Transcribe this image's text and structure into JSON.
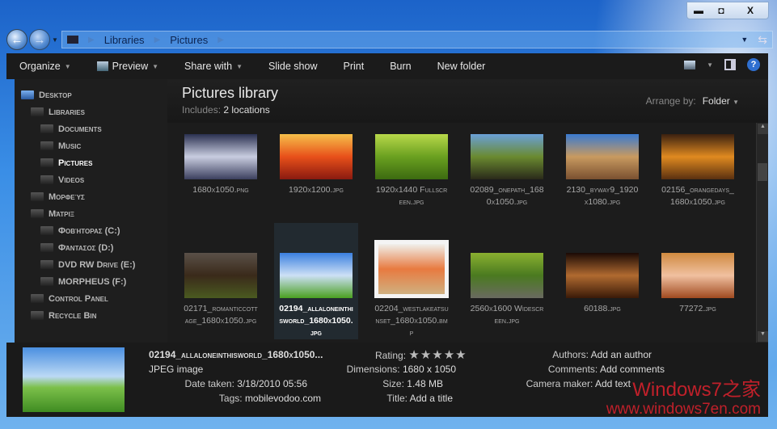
{
  "window": {
    "minimize": "▬",
    "maximize": "◘",
    "close": "X"
  },
  "address": {
    "crumbs": [
      "Libraries",
      "Pictures"
    ]
  },
  "toolbar": {
    "items": [
      {
        "label": "Organize",
        "caret": true
      },
      {
        "label": "Preview",
        "caret": true
      },
      {
        "label": "Share with",
        "caret": true
      },
      {
        "label": "Slide show"
      },
      {
        "label": "Print"
      },
      {
        "label": "Burn"
      },
      {
        "label": "New folder"
      }
    ],
    "help": "?"
  },
  "sidebar": {
    "items": [
      {
        "label": "Desktop",
        "level": 0
      },
      {
        "label": "Libraries",
        "level": 1
      },
      {
        "label": "Documents",
        "level": 2
      },
      {
        "label": "Music",
        "level": 2
      },
      {
        "label": "Pictures",
        "level": 2,
        "selected": true
      },
      {
        "label": "Videos",
        "level": 2
      },
      {
        "label": "Μορφεύς",
        "level": 1
      },
      {
        "label": "Μάτριξ",
        "level": 1
      },
      {
        "label": "Φοβήτορας (C:)",
        "level": 2
      },
      {
        "label": "Φάντασος (D:)",
        "level": 2
      },
      {
        "label": "DVD RW Drive (E:)",
        "level": 2
      },
      {
        "label": "MORPHEUS (F:)",
        "level": 2
      },
      {
        "label": "Control Panel",
        "level": 1
      },
      {
        "label": "Recycle Bin",
        "level": 1
      }
    ]
  },
  "library": {
    "title": "Pictures library",
    "includes_label": "Includes:",
    "includes_value": "2 locations",
    "arrange_label": "Arrange by:",
    "arrange_value": "Folder"
  },
  "files": [
    {
      "name": "1680x1050.png",
      "colors": [
        "#2a3050",
        "#c9cde0",
        "#3b3f5e"
      ]
    },
    {
      "name": "1920x1200.jpg",
      "colors": [
        "#f6c04a",
        "#e8501a",
        "#8a1a10"
      ]
    },
    {
      "name": "1920x1440 Fullscreen.jpg",
      "colors": [
        "#b8d84a",
        "#6aa020",
        "#3c6a10"
      ]
    },
    {
      "name": "02089_onepath_1680x1050.jpg",
      "colors": [
        "#6aa0d8",
        "#6a8a30",
        "#2a2a1a"
      ]
    },
    {
      "name": "2130_byway9_1920x1080.jpg",
      "colors": [
        "#3a7ad0",
        "#c89a60",
        "#7a5030"
      ]
    },
    {
      "name": "02156_orangedays_1680x1050.jpg",
      "colors": [
        "#3a2010",
        "#e08a20",
        "#5a3010"
      ]
    },
    {
      "name": "02171_romanticcottage_1680x1050.jpg",
      "colors": [
        "#5a5048",
        "#3a2a1a",
        "#4a5a20"
      ]
    },
    {
      "name": "02194_allaloneinthisworld_1680x1050.jpg",
      "colors": [
        "#3a80e0",
        "#cde0f5",
        "#4aa020"
      ],
      "selected": true
    },
    {
      "name": "02204_westlakeatsunset_1680x1050.bmp",
      "colors": [
        "#f0f0ec",
        "#e87a40",
        "#d0b080"
      ]
    },
    {
      "name": "2560x1600 Widescreen.jpg",
      "colors": [
        "#8ab030",
        "#4a7a20",
        "#6a6a60"
      ]
    },
    {
      "name": "60188.jpg",
      "colors": [
        "#1a0a05",
        "#b06a30",
        "#3a1a08"
      ]
    },
    {
      "name": "77272.jpg",
      "colors": [
        "#d08a40",
        "#f0c0a0",
        "#a04a20"
      ]
    }
  ],
  "details": {
    "filename": "02194_allaloneinthisworld_1680x1050...",
    "type": "JPEG image",
    "date_label": "Date taken:",
    "date": "3/18/2010 05:56",
    "tags_label": "Tags:",
    "tags": "mobilevodoo.com",
    "rating_label": "Rating:",
    "rating": 5,
    "rating_max": 5,
    "dim_label": "Dimensions:",
    "dim": "1680 x 1050",
    "size_label": "Size:",
    "size": "1.48 MB",
    "title_label": "Title:",
    "title": "Add a title",
    "authors_label": "Authors:",
    "authors": "Add an author",
    "comments_label": "Comments:",
    "comments": "Add comments",
    "camera_label": "Camera maker:",
    "camera": "Add text"
  },
  "watermark": {
    "line1": "Windows7之家",
    "line2": "www.windows7en.com"
  }
}
